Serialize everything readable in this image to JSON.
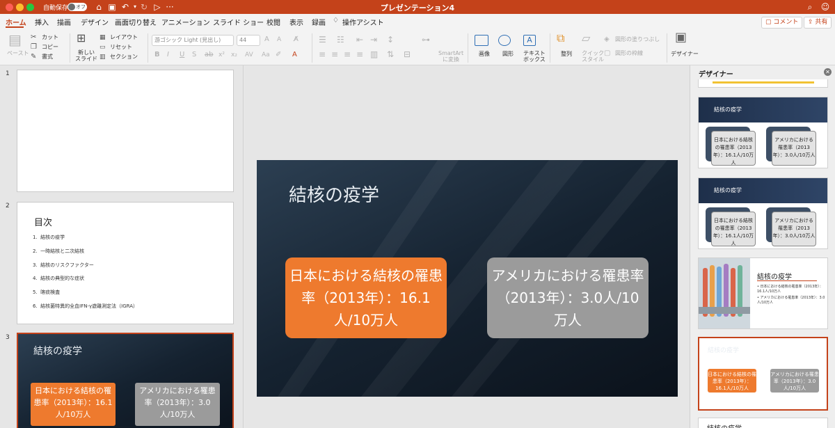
{
  "titlebar": {
    "autosave_label": "自動保存",
    "autosave_state": "オフ",
    "document_title": "プレゼンテーション4"
  },
  "tabs": [
    {
      "label": "ホーム",
      "active": true
    },
    {
      "label": "挿入"
    },
    {
      "label": "描画"
    },
    {
      "label": "デザイン"
    },
    {
      "label": "画面切り替え"
    },
    {
      "label": "アニメーション"
    },
    {
      "label": "スライド ショー"
    },
    {
      "label": "校閲"
    },
    {
      "label": "表示"
    },
    {
      "label": "録画"
    },
    {
      "label": "操作アシスト"
    }
  ],
  "top_right": {
    "comment_label": "コメント",
    "share_label": "共有"
  },
  "ribbon": {
    "paste": "ペースト",
    "cut": "カット",
    "copy": "コピー",
    "format": "書式",
    "new_slide_1": "新しい",
    "new_slide_2": "スライド",
    "layout": "レイアウト",
    "reset": "リセット",
    "section": "セクション",
    "font_name": "游ゴシック Light (見出し)",
    "font_size": "44",
    "smartart_1": "SmartArt",
    "smartart_2": "に変換",
    "image": "画像",
    "shape": "図形",
    "textbox_1": "テキスト",
    "textbox_2": "ボックス",
    "arrange": "整列",
    "quick_style_1": "クイック",
    "quick_style_2": "スタイル",
    "shape_fill": "図形の塗りつぶし",
    "shape_outline": "図形の枠線",
    "designer": "デザイナー"
  },
  "thumbnails": {
    "slide1": {
      "number": "1"
    },
    "slide2": {
      "number": "2",
      "title": "目次",
      "items": [
        "1.  結核の疫学",
        "2.  一時結核と二次結核",
        "3.  結核のリスクファクター",
        "4.  結核の典型的な症状",
        "5.  喀痰検査",
        "6.  結核菌特異的全血IFN-γ遊離測定法（IGRA）"
      ]
    },
    "slide3": {
      "number": "3",
      "title": "結核の疫学",
      "box_left": "日本における結核の罹患率（2013年）：16.1人/10万人",
      "box_right": "アメリカにおける罹患率（2013年）：3.0人/10万人"
    }
  },
  "slide": {
    "title": "結核の疫学",
    "box_left": "日本における結核の罹患率（2013年）：16.1人/10万人",
    "box_right": "アメリカにおける罹患率（2013年）：3.0人/10万人"
  },
  "designer": {
    "title": "デザイナー",
    "card_title": "結核の疫学",
    "box_left": "日本における結核の罹患率（2013年）：16.1人/10万人",
    "box_right": "アメリカにおける罹患率（2013年）：3.0人/10万人",
    "photo_bullet_1": "• 日本における結核の罹患率（2013年）：16.1人/10万人",
    "photo_bullet_2": "• アメリカにおける罹患率（2013年）：3.0人/10万人",
    "partial_title": "結核の疫学"
  },
  "colors": {
    "accent": "#c4421a",
    "orange_box": "#ee7a2e",
    "gray_box": "#9b9b9b"
  }
}
